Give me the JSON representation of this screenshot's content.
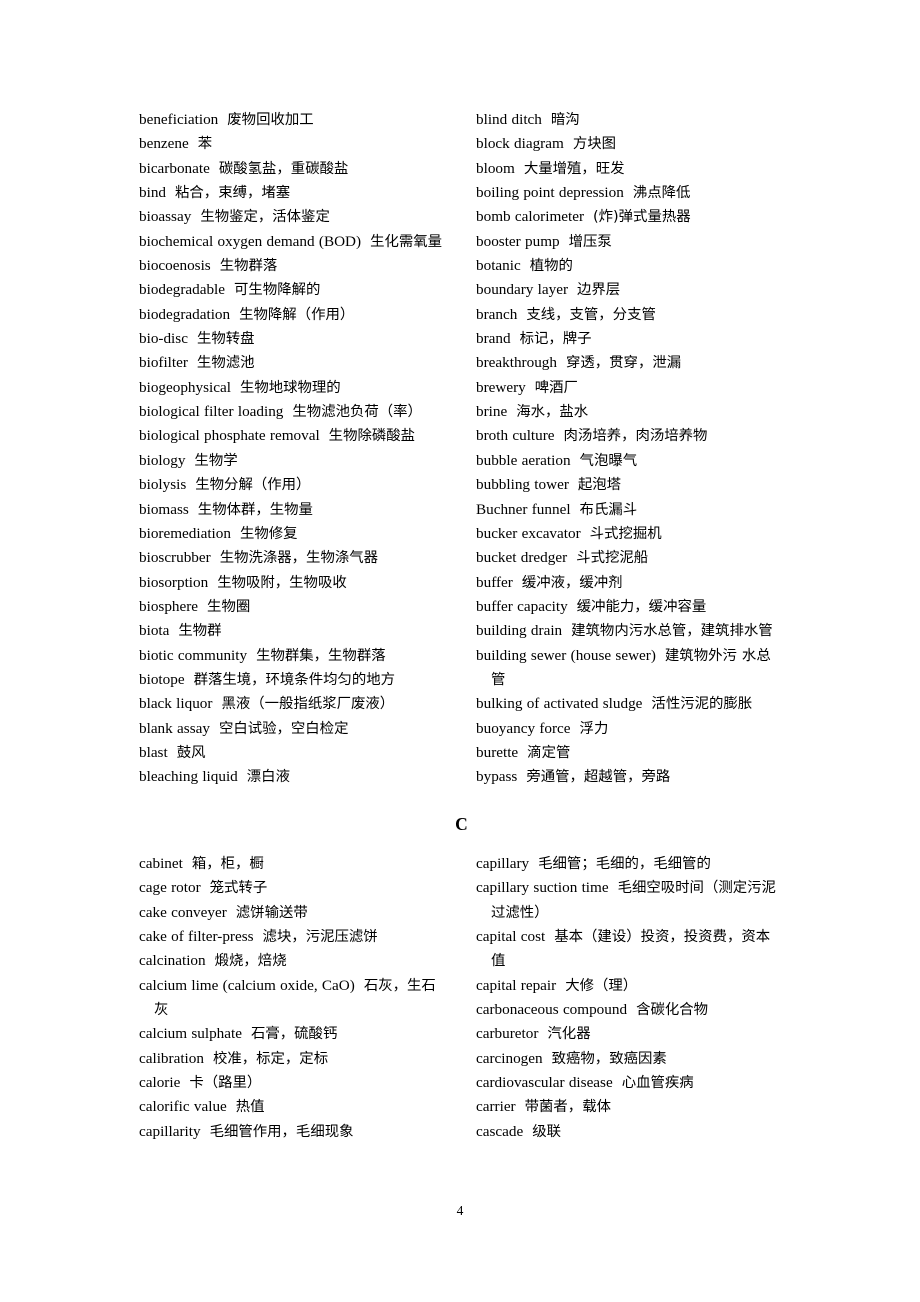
{
  "document": {
    "page_number": "4",
    "section_letter": "C"
  },
  "band_b": {
    "left_entries": [
      {
        "term": "beneficiation",
        "gloss": "废物回收加工"
      },
      {
        "term": "benzene",
        "gloss": "苯"
      },
      {
        "term": "bicarbonate",
        "gloss": "碳酸氢盐，重碳酸盐"
      },
      {
        "term": "bind",
        "gloss": "粘合，束缚，堵塞"
      },
      {
        "term": "bioassay",
        "gloss": "生物鉴定，活体鉴定"
      },
      {
        "term": "biochemical oxygen demand (BOD)",
        "gloss": "生化需氧量"
      },
      {
        "term": "biocoenosis",
        "gloss": "生物群落"
      },
      {
        "term": "biodegradable",
        "gloss": "可生物降解的"
      },
      {
        "term": "biodegradation",
        "gloss": "生物降解（作用）"
      },
      {
        "term": "bio-disc",
        "gloss": "生物转盘"
      },
      {
        "term": "biofilter",
        "gloss": "生物滤池"
      },
      {
        "term": "biogeophysical",
        "gloss": "生物地球物理的"
      },
      {
        "term": "biological filter loading",
        "gloss": "生物滤池负荷（率）"
      },
      {
        "term": "biological phosphate removal",
        "gloss": "生物除磷酸盐"
      },
      {
        "term": "biology",
        "gloss": "生物学"
      },
      {
        "term": "biolysis",
        "gloss": "生物分解（作用）"
      },
      {
        "term": "biomass",
        "gloss": "生物体群，生物量"
      },
      {
        "term": "bioremediation",
        "gloss": "生物修复"
      },
      {
        "term": "bioscrubber",
        "gloss": "生物洗涤器，生物涤气器"
      },
      {
        "term": "biosorption",
        "gloss": "生物吸附，生物吸收"
      },
      {
        "term": "biosphere",
        "gloss": "生物圈"
      },
      {
        "term": "biota",
        "gloss": "生物群"
      },
      {
        "term": "biotic community",
        "gloss": "生物群集，生物群落"
      },
      {
        "term": "biotope",
        "gloss": "群落生境，环境条件均匀的地方"
      },
      {
        "term": "black liquor",
        "gloss": "黑液（一般指纸浆厂废液）"
      },
      {
        "term": "blank assay",
        "gloss": "空白试验，空白检定"
      },
      {
        "term": "blast",
        "gloss": "鼓风"
      },
      {
        "term": "bleaching liquid",
        "gloss": "漂白液"
      }
    ],
    "right_entries": [
      {
        "term": "blind ditch",
        "gloss": "暗沟"
      },
      {
        "term": "block diagram",
        "gloss": "方块图"
      },
      {
        "term": "bloom",
        "gloss": "大量增殖，旺发"
      },
      {
        "term": "boiling point depression",
        "gloss": "沸点降低"
      },
      {
        "term": "bomb calorimeter",
        "gloss": "(炸)弹式量热器"
      },
      {
        "term": "booster pump",
        "gloss": "增压泵"
      },
      {
        "term": "botanic",
        "gloss": "植物的"
      },
      {
        "term": "boundary layer",
        "gloss": "边界层"
      },
      {
        "term": "branch",
        "gloss": "支线，支管，分支管"
      },
      {
        "term": "brand",
        "gloss": "标记，牌子"
      },
      {
        "term": "breakthrough",
        "gloss": "穿透，贯穿，泄漏"
      },
      {
        "term": "brewery",
        "gloss": "啤酒厂"
      },
      {
        "term": "brine",
        "gloss": "海水，盐水"
      },
      {
        "term": "broth culture",
        "gloss": "肉汤培养，肉汤培养物"
      },
      {
        "term": "bubble aeration",
        "gloss": "气泡曝气"
      },
      {
        "term": "bubbling tower",
        "gloss": "起泡塔"
      },
      {
        "term": "Buchner funnel",
        "gloss": "布氏漏斗"
      },
      {
        "term": "bucker excavator",
        "gloss": "斗式挖掘机"
      },
      {
        "term": "bucket dredger",
        "gloss": "斗式挖泥船"
      },
      {
        "term": "buffer",
        "gloss": "缓冲液，缓冲剂"
      },
      {
        "term": "buffer capacity",
        "gloss": "缓冲能力，缓冲容量"
      },
      {
        "term": "building drain",
        "gloss": "建筑物内污水总管，建筑排水管"
      },
      {
        "term": "building sewer (house sewer)",
        "gloss": "建筑物外污 水总管"
      },
      {
        "term": "bulking of activated sludge",
        "gloss": "活性污泥的膨胀"
      },
      {
        "term": "buoyancy force",
        "gloss": "浮力"
      },
      {
        "term": "burette",
        "gloss": "滴定管"
      },
      {
        "term": "bypass",
        "gloss": "旁通管，超越管，旁路"
      }
    ]
  },
  "band_c": {
    "left_entries": [
      {
        "term": "cabinet",
        "gloss": "箱，柜，橱"
      },
      {
        "term": "cage rotor",
        "gloss": "笼式转子"
      },
      {
        "term": "cake conveyer",
        "gloss": "滤饼输送带"
      },
      {
        "term": "cake of filter-press",
        "gloss": "滤块，污泥压滤饼"
      },
      {
        "term": "calcination",
        "gloss": "煅烧，焙烧"
      },
      {
        "term": "calcium lime (calcium oxide, CaO)",
        "gloss": "石灰，生石灰"
      },
      {
        "term": "calcium sulphate",
        "gloss": "石膏，硫酸钙"
      },
      {
        "term": "calibration",
        "gloss": "校准，标定，定标"
      },
      {
        "term": "calorie",
        "gloss": "卡（路里）"
      },
      {
        "term": "calorific value",
        "gloss": "热值"
      },
      {
        "term": "capillarity",
        "gloss": "毛细管作用，毛细现象"
      }
    ],
    "right_entries": [
      {
        "term": "capillary",
        "gloss": "毛细管；毛细的，毛细管的"
      },
      {
        "term": "capillary suction time",
        "gloss": "毛细空吸时间（测定污泥过滤性）"
      },
      {
        "term": "capital cost",
        "gloss": "基本（建设）投资，投资费，资本值"
      },
      {
        "term": "capital repair",
        "gloss": "大修（理）"
      },
      {
        "term": "carbonaceous compound",
        "gloss": "含碳化合物"
      },
      {
        "term": "carburetor",
        "gloss": "汽化器"
      },
      {
        "term": "carcinogen",
        "gloss": "致癌物，致癌因素"
      },
      {
        "term": "cardiovascular disease",
        "gloss": "心血管疾病"
      },
      {
        "term": "carrier",
        "gloss": "带菌者，载体"
      },
      {
        "term": "cascade",
        "gloss": "级联"
      }
    ]
  }
}
